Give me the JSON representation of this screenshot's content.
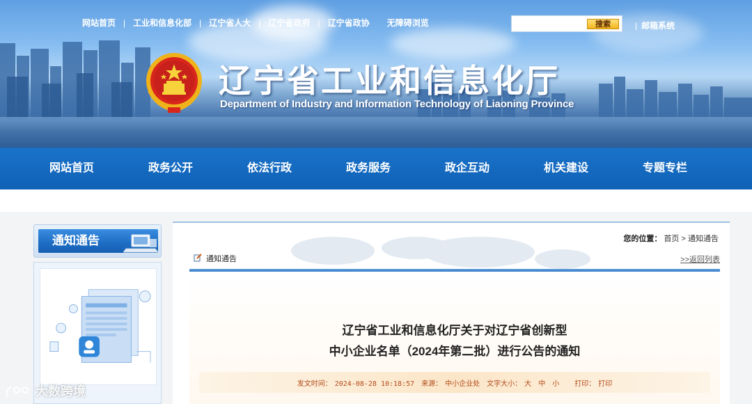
{
  "top_links": [
    "网站首页",
    "工业和信息化部",
    "辽宁省人大",
    "辽宁省政府",
    "辽宁省政协",
    "无障碍浏览"
  ],
  "search": {
    "button_label": "搜索",
    "value": ""
  },
  "mail_link": "邮箱系统",
  "site": {
    "title": "辽宁省工业和信息化厅",
    "subtitle": "Department of Industry and Information Technology of Liaoning Province"
  },
  "nav": [
    "网站首页",
    "政务公开",
    "依法行政",
    "政务服务",
    "政企互动",
    "机关建设",
    "专题专栏"
  ],
  "sidebar": {
    "title": "通知通告"
  },
  "breadcrumb": {
    "label": "您的位置：",
    "home": "首页",
    "sep": ">",
    "current": "通知通告"
  },
  "section": {
    "label": "通知通告",
    "back_link": ">>返回列表"
  },
  "article": {
    "title_line1": "辽宁省工业和信息化厅关于对辽宁省创新型",
    "title_line2": "中小企业名单（2024年第二批）进行公告的通知",
    "date_label": "发文时间：",
    "date": "2024-08-28 10:18:57",
    "source_label": "来源：",
    "source": "中小企业处",
    "fontsize_label": "文字大小：",
    "size_large": "大",
    "size_medium": "中",
    "size_small": "小",
    "print_label": "打印：",
    "print_link": "打印"
  },
  "watermark": "大数跨境",
  "colors": {
    "nav_blue": "#1567bd",
    "meta_orange": "#b24a1a",
    "search_gold": "#f3b51b"
  }
}
